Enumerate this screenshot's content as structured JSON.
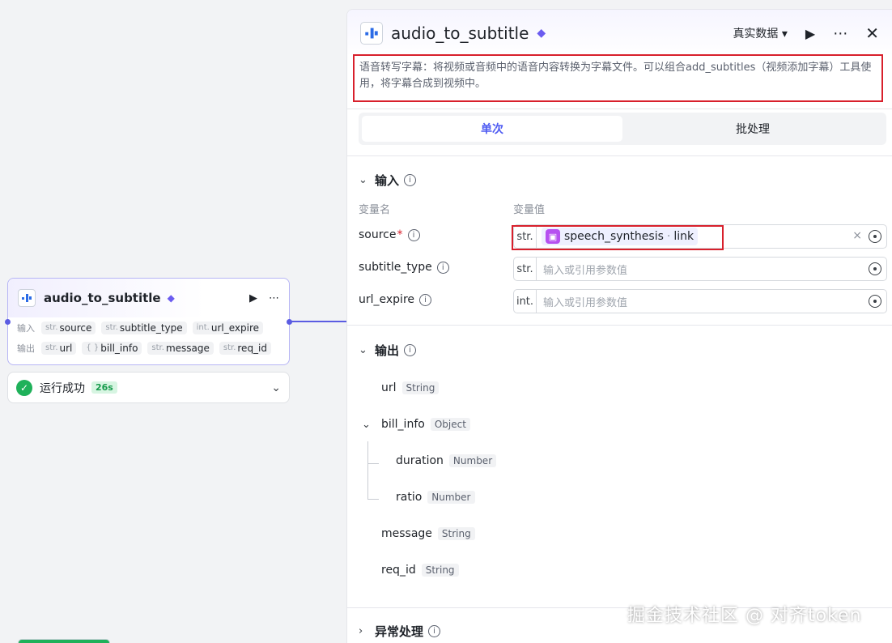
{
  "canvas": {
    "node": {
      "title": "audio_to_subtitle",
      "input_label": "输入",
      "output_label": "输出",
      "inputs": [
        {
          "type": "str.",
          "name": "source"
        },
        {
          "type": "str.",
          "name": "subtitle_type"
        },
        {
          "type": "int.",
          "name": "url_expire"
        }
      ],
      "outputs": [
        {
          "type": "str.",
          "name": "url"
        },
        {
          "type": "{ }",
          "name": "bill_info"
        },
        {
          "type": "str.",
          "name": "message"
        },
        {
          "type": "str.",
          "name": "req_id"
        }
      ]
    },
    "status": {
      "text": "运行成功",
      "time": "26s"
    }
  },
  "panel": {
    "title": "audio_to_subtitle",
    "data_mode": "真实数据",
    "description": "语音转写字幕：将视频或音频中的语音内容转换为字幕文件。可以组合add_subtitles（视频添加字幕）工具使用，将字幕合成到视频中。",
    "tabs": [
      "单次",
      "批处理"
    ],
    "input_section": "输入",
    "col_name": "变量名",
    "col_value": "变量值",
    "inputs": [
      {
        "name": "source",
        "type": "str.",
        "ref_node": "speech_synthesis",
        "ref_field": "link"
      },
      {
        "name": "subtitle_type",
        "type": "str.",
        "placeholder": "输入或引用参数值"
      },
      {
        "name": "url_expire",
        "type": "int.",
        "placeholder": "输入或引用参数值"
      }
    ],
    "output_section": "输出",
    "outputs": [
      {
        "name": "url",
        "type": "String"
      },
      {
        "name": "bill_info",
        "type": "Object"
      },
      {
        "name": "duration",
        "type": "Number"
      },
      {
        "name": "ratio",
        "type": "Number"
      },
      {
        "name": "message",
        "type": "String"
      },
      {
        "name": "req_id",
        "type": "String"
      }
    ],
    "exception_section": "异常处理"
  },
  "watermark": "掘金技术社区 @ 对齐token",
  "colors": {
    "accent": "#4e5bf2",
    "success": "#1fb15a",
    "highlight_border": "#d8202c",
    "node_border": "#b7b5f5"
  }
}
